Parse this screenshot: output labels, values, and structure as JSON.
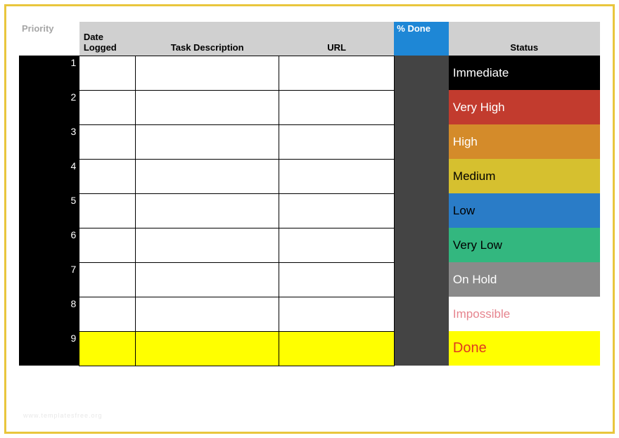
{
  "headers": {
    "priority": "Priority",
    "date_logged": "Date Logged",
    "task_description": "Task Description",
    "url": "URL",
    "percent_done": "% Done",
    "status": "Status"
  },
  "rows": [
    {
      "n": "1",
      "status": "Immediate",
      "status_class": "st-immediate"
    },
    {
      "n": "2",
      "status": "Very High",
      "status_class": "st-veryhigh"
    },
    {
      "n": "3",
      "status": "High",
      "status_class": "st-high"
    },
    {
      "n": "4",
      "status": "Medium",
      "status_class": "st-medium"
    },
    {
      "n": "5",
      "status": "Low",
      "status_class": "st-low"
    },
    {
      "n": "6",
      "status": "Very Low",
      "status_class": "st-verylow"
    },
    {
      "n": "7",
      "status": "On Hold",
      "status_class": "st-onhold"
    },
    {
      "n": "8",
      "status": "Impossible",
      "status_class": "st-impossible"
    },
    {
      "n": "9",
      "status": "Done",
      "status_class": "st-done",
      "highlight": true
    }
  ],
  "watermark": "www.templatesfree.org"
}
